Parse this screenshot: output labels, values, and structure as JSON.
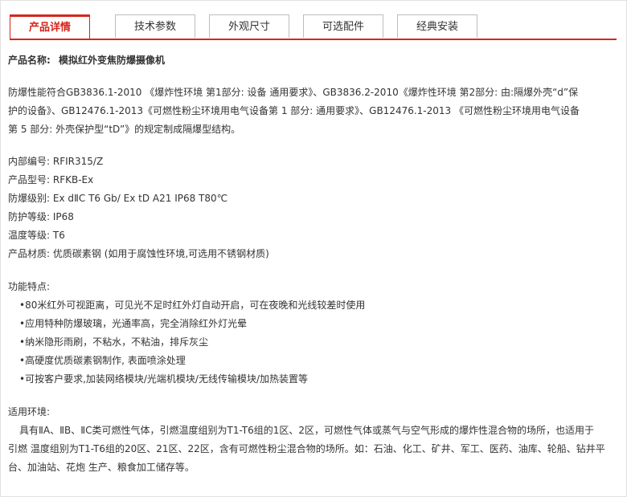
{
  "tabs": [
    {
      "label": "产品详情",
      "active": true
    },
    {
      "label": "技术参数",
      "active": false
    },
    {
      "label": "外观尺寸",
      "active": false
    },
    {
      "label": "可选配件",
      "active": false
    },
    {
      "label": "经典安装",
      "active": false
    }
  ],
  "accent_color": "#d7251c",
  "product": {
    "name_label": "产品名称:",
    "name_value": "模拟红外变焦防爆摄像机"
  },
  "compliance": {
    "line1": "防爆性能符合GB3836.1-2010 《爆炸性环境 第1部分: 设备 通用要求》、GB3836.2-2010《爆炸性环境 第2部分: 由:隔爆外壳“d”保",
    "line2": "护的设备》、GB12476.1-2013《可燃性粉尘环境用电气设备第 1 部分: 通用要求》、GB12476.1-2013 《可燃性粉尘环境用电气设备",
    "line3": "第 5 部分: 外壳保护型“tD”》的规定制成隔爆型结构。"
  },
  "specs": [
    {
      "label": "内部编号:",
      "value": "RFIR315/Z"
    },
    {
      "label": "产品型号:",
      "value": "RFKB-Ex"
    },
    {
      "label": "防爆级别:",
      "value": "Ex dⅡC T6 Gb/ Ex tD A21 IP68 T80℃"
    },
    {
      "label": "防护等级:",
      "value": "IP68"
    },
    {
      "label": "温度等级:",
      "value": "T6"
    },
    {
      "label": "产品材质:",
      "value": "优质碳素钢 (如用于腐蚀性环境,可选用不锈钢材质)"
    }
  ],
  "features": {
    "heading": "功能特点:",
    "items": [
      "•80米红外可视距离，可见光不足时红外灯自动开启，可在夜晚和光线较差时使用",
      "•应用特种防爆玻璃，光通率高，完全消除红外灯光晕",
      "•纳米隐形雨刷，不粘水，不粘油，排斥灰尘",
      "•高硬度优质碳素钢制作, 表面喷涂处理",
      "•可按客户要求,加装网络模块/光端机模块/无线传输模块/加热装置等"
    ]
  },
  "environment": {
    "heading": "适用环境:",
    "line1": "具有ⅡA、ⅡB、ⅡC类可燃性气体，引燃温度组别为T1-T6组的1区、2区，可燃性气体或蒸气与空气形成的爆炸性混合物的场所，也适用于",
    "line2": "引燃 温度组别为T1-T6组的20区、21区、22区，含有可燃性粉尘混合物的场所。如：石油、化工、矿井、军工、医药、油库、轮船、钻井平",
    "line3": "台、加油站、花炮 生产、粮食加工储存等。"
  }
}
